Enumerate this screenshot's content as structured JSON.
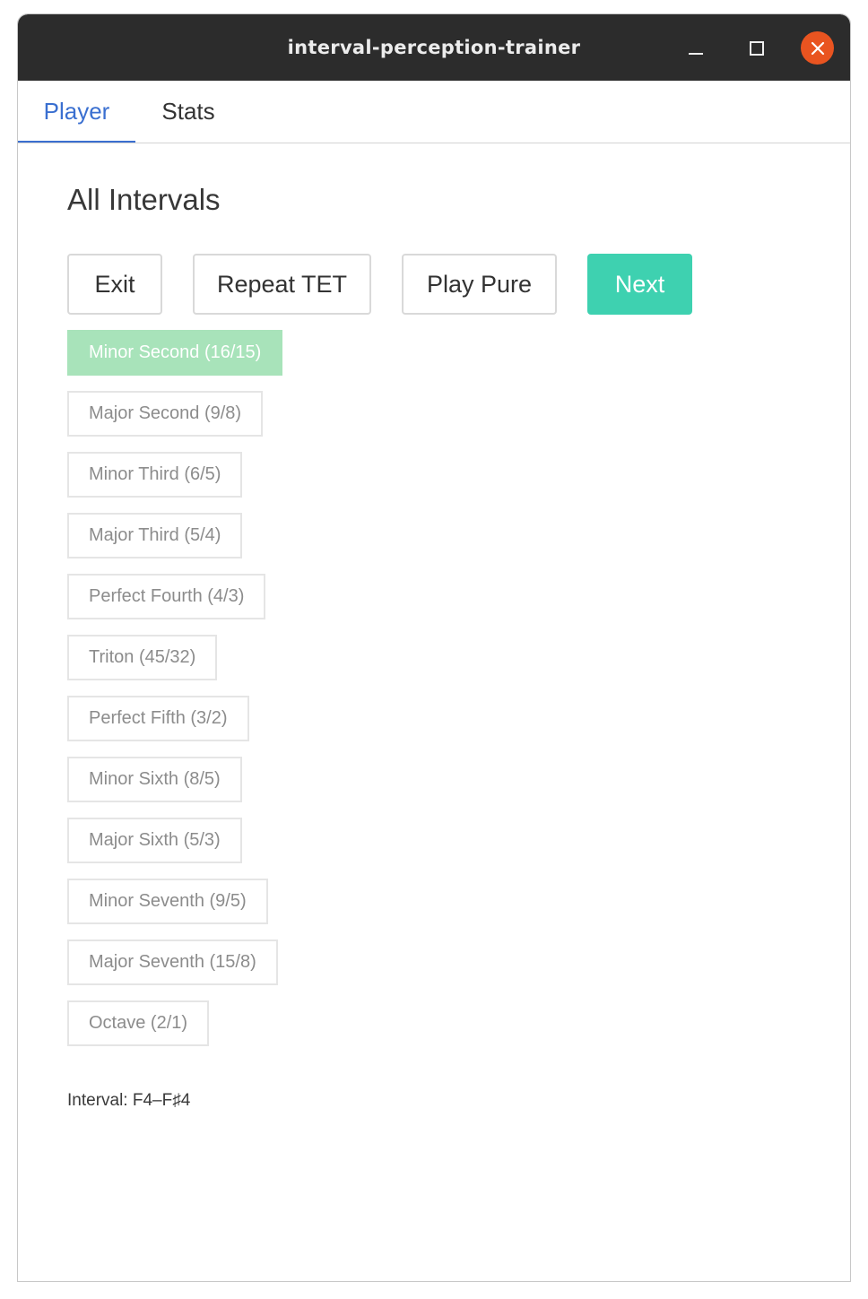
{
  "window": {
    "title": "interval-perception-trainer",
    "controls": {
      "minimize_icon": "minimize-icon",
      "maximize_icon": "maximize-icon",
      "close_icon": "close-icon",
      "close_color": "#e95420"
    }
  },
  "tabs": [
    {
      "label": "Player",
      "active": true
    },
    {
      "label": "Stats",
      "active": false
    }
  ],
  "player": {
    "heading": "All Intervals",
    "actions": {
      "exit": "Exit",
      "repeat_tet": "Repeat TET",
      "play_pure": "Play Pure",
      "next": "Next"
    },
    "intervals": [
      {
        "label": "Minor Second (16/15)",
        "state": "correct"
      },
      {
        "label": "Major Second (9/8)",
        "state": "disabled"
      },
      {
        "label": "Minor Third (6/5)",
        "state": "disabled"
      },
      {
        "label": "Major Third (5/4)",
        "state": "disabled"
      },
      {
        "label": "Perfect Fourth (4/3)",
        "state": "disabled"
      },
      {
        "label": "Triton (45/32)",
        "state": "disabled"
      },
      {
        "label": "Perfect Fifth (3/2)",
        "state": "disabled"
      },
      {
        "label": "Minor Sixth (8/5)",
        "state": "disabled"
      },
      {
        "label": "Major Sixth (5/3)",
        "state": "disabled"
      },
      {
        "label": "Minor Seventh (9/5)",
        "state": "disabled"
      },
      {
        "label": "Major Seventh (15/8)",
        "state": "disabled"
      },
      {
        "label": "Octave (2/1)",
        "state": "disabled"
      }
    ],
    "status": "Interval: F4–F♯4"
  },
  "colors": {
    "accent": "#3a6fd0",
    "next_button": "#3ed1b0",
    "correct_answer": "#a8e3ba",
    "titlebar": "#2c2c2c"
  }
}
